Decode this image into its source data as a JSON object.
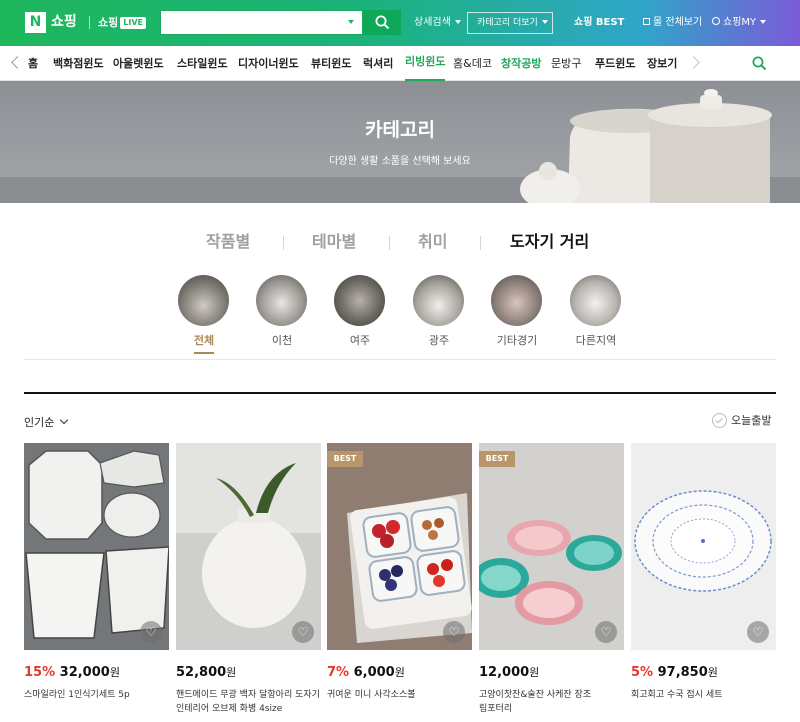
{
  "header": {
    "logo_letter": "N",
    "logo_text": "쇼핑",
    "live_text": "쇼핑",
    "live_badge": "LIVE",
    "search_placeholder": "",
    "detail_search": "상세검색",
    "more_categories": "카테고리 더보기",
    "best": "쇼핑 BEST",
    "all_view": "몰 전체보기",
    "my": "쇼핑MY"
  },
  "category_nav": {
    "items": [
      "홈",
      "백화점윈도",
      "아울렛윈도",
      "스타일윈도",
      "디자이너윈도",
      "뷰티윈도",
      "럭셔리",
      "리빙윈도",
      "홈&데코",
      "창작공방",
      "문방구",
      "푸드윈도",
      "장보기"
    ],
    "active_color": "#1fa85a"
  },
  "banner": {
    "title": "카테고리",
    "subtitle": "다양한 생활 소품을 선택해 보세요"
  },
  "tabs": [
    "작품별",
    "테마별",
    "취미",
    "도자기 거리"
  ],
  "subcategories": [
    "전체",
    "이천",
    "여주",
    "광주",
    "기타경기",
    "다른지역"
  ],
  "sort": {
    "label": "인기순",
    "today_ship": "오늘출발"
  },
  "products": [
    {
      "discount": "15%",
      "price": "32,000",
      "unit": "원",
      "name": "스마일라인 1인식기세트 5p",
      "best": false
    },
    {
      "discount": "",
      "price": "52,800",
      "unit": "원",
      "name": "핸드메이드 무광 백자 달항아리 도자기 인테리어 오브제 화병 4size",
      "best": false
    },
    {
      "discount": "7%",
      "price": "6,000",
      "unit": "원",
      "name": "귀여운 미니 사각소스볼",
      "best": true
    },
    {
      "discount": "",
      "price": "12,000",
      "unit": "원",
      "name": "고양이찻잔&술잔 사케잔 장조림포터리",
      "best": true
    },
    {
      "discount": "5%",
      "price": "97,850",
      "unit": "원",
      "name": "회고회고 수국 접시 세트",
      "best": false
    }
  ],
  "best_label": "BEST",
  "colors": {
    "green": "#1fb75c",
    "accent_brown": "#a88a5c",
    "sale_red": "#e23a2f"
  }
}
